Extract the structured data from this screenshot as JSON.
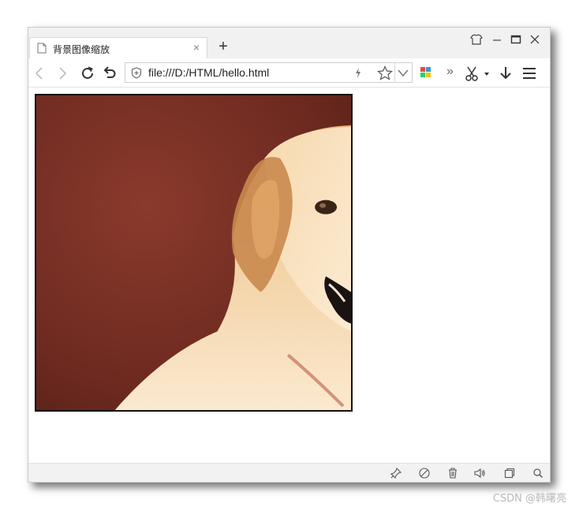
{
  "tab": {
    "title": "背景图像缩放",
    "close": "×"
  },
  "new_tab": "+",
  "address": {
    "url": "file:///D:/HTML/hello.html"
  },
  "toolbar": {
    "more": "»"
  },
  "content": {
    "background_image": "golden-retriever-photo"
  },
  "watermark": "CSDN @韩曙亮"
}
